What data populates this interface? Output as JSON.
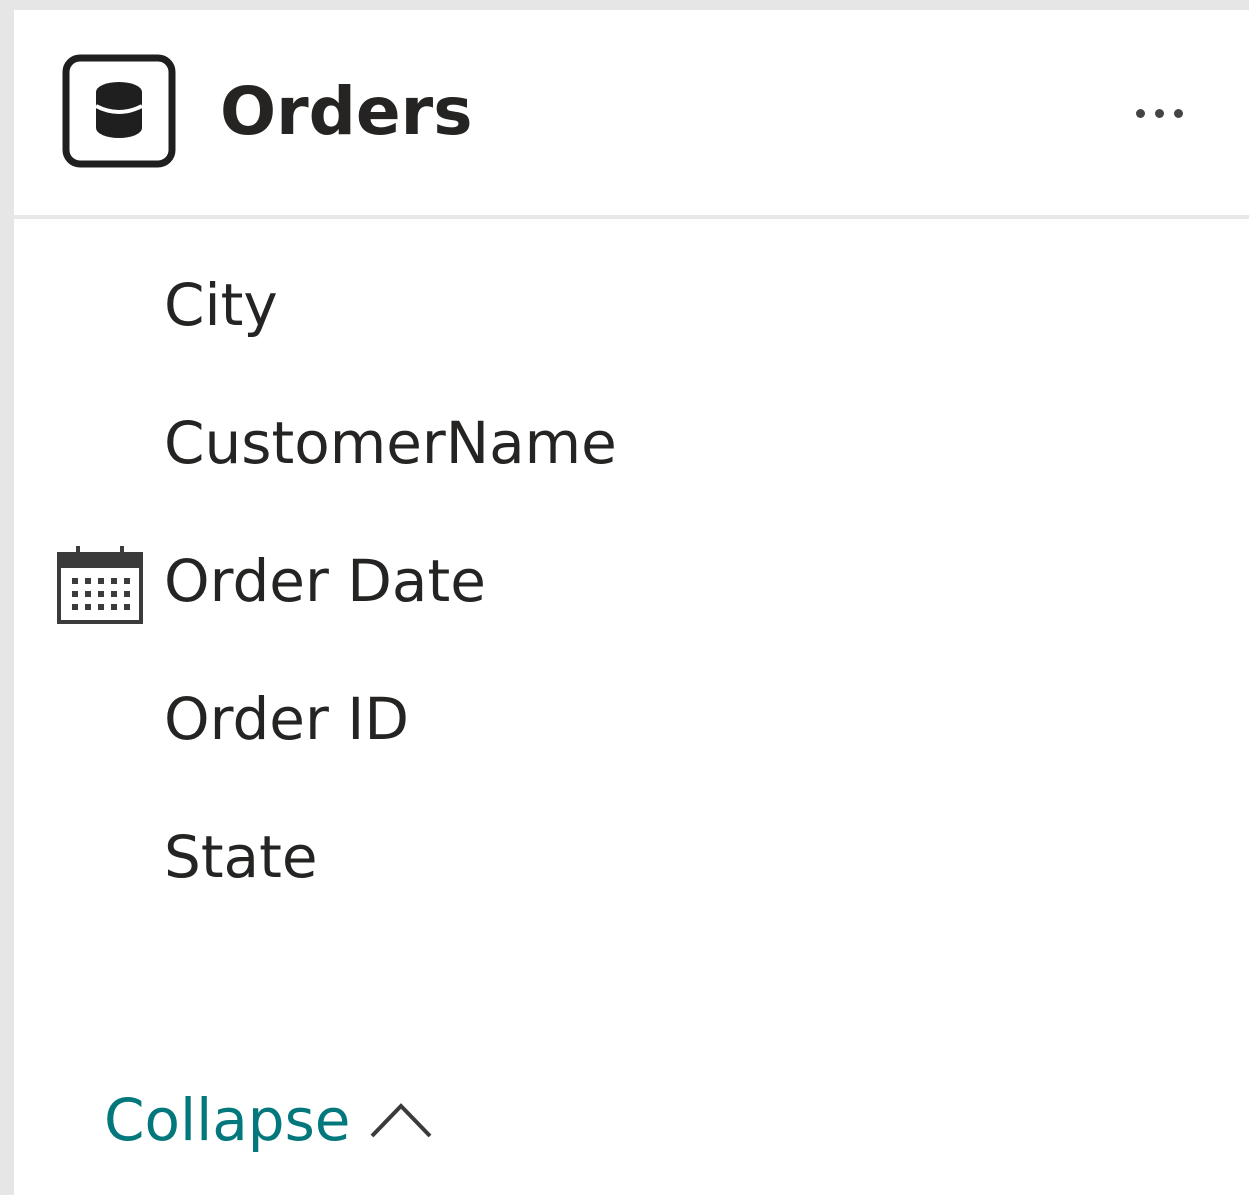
{
  "table": {
    "name": "Orders",
    "icon": "table-icon",
    "more_icon": "more-options-icon"
  },
  "fields": [
    {
      "label": "City",
      "icon": null
    },
    {
      "label": "CustomerName",
      "icon": null
    },
    {
      "label": "Order Date",
      "icon": "calendar-icon"
    },
    {
      "label": "Order ID",
      "icon": null
    },
    {
      "label": "State",
      "icon": null
    }
  ],
  "footer": {
    "collapse_label": "Collapse",
    "collapse_icon": "chevron-up-icon"
  },
  "colors": {
    "accent": "#03787c",
    "text": "#252423",
    "divider": "#e8e8e8"
  }
}
